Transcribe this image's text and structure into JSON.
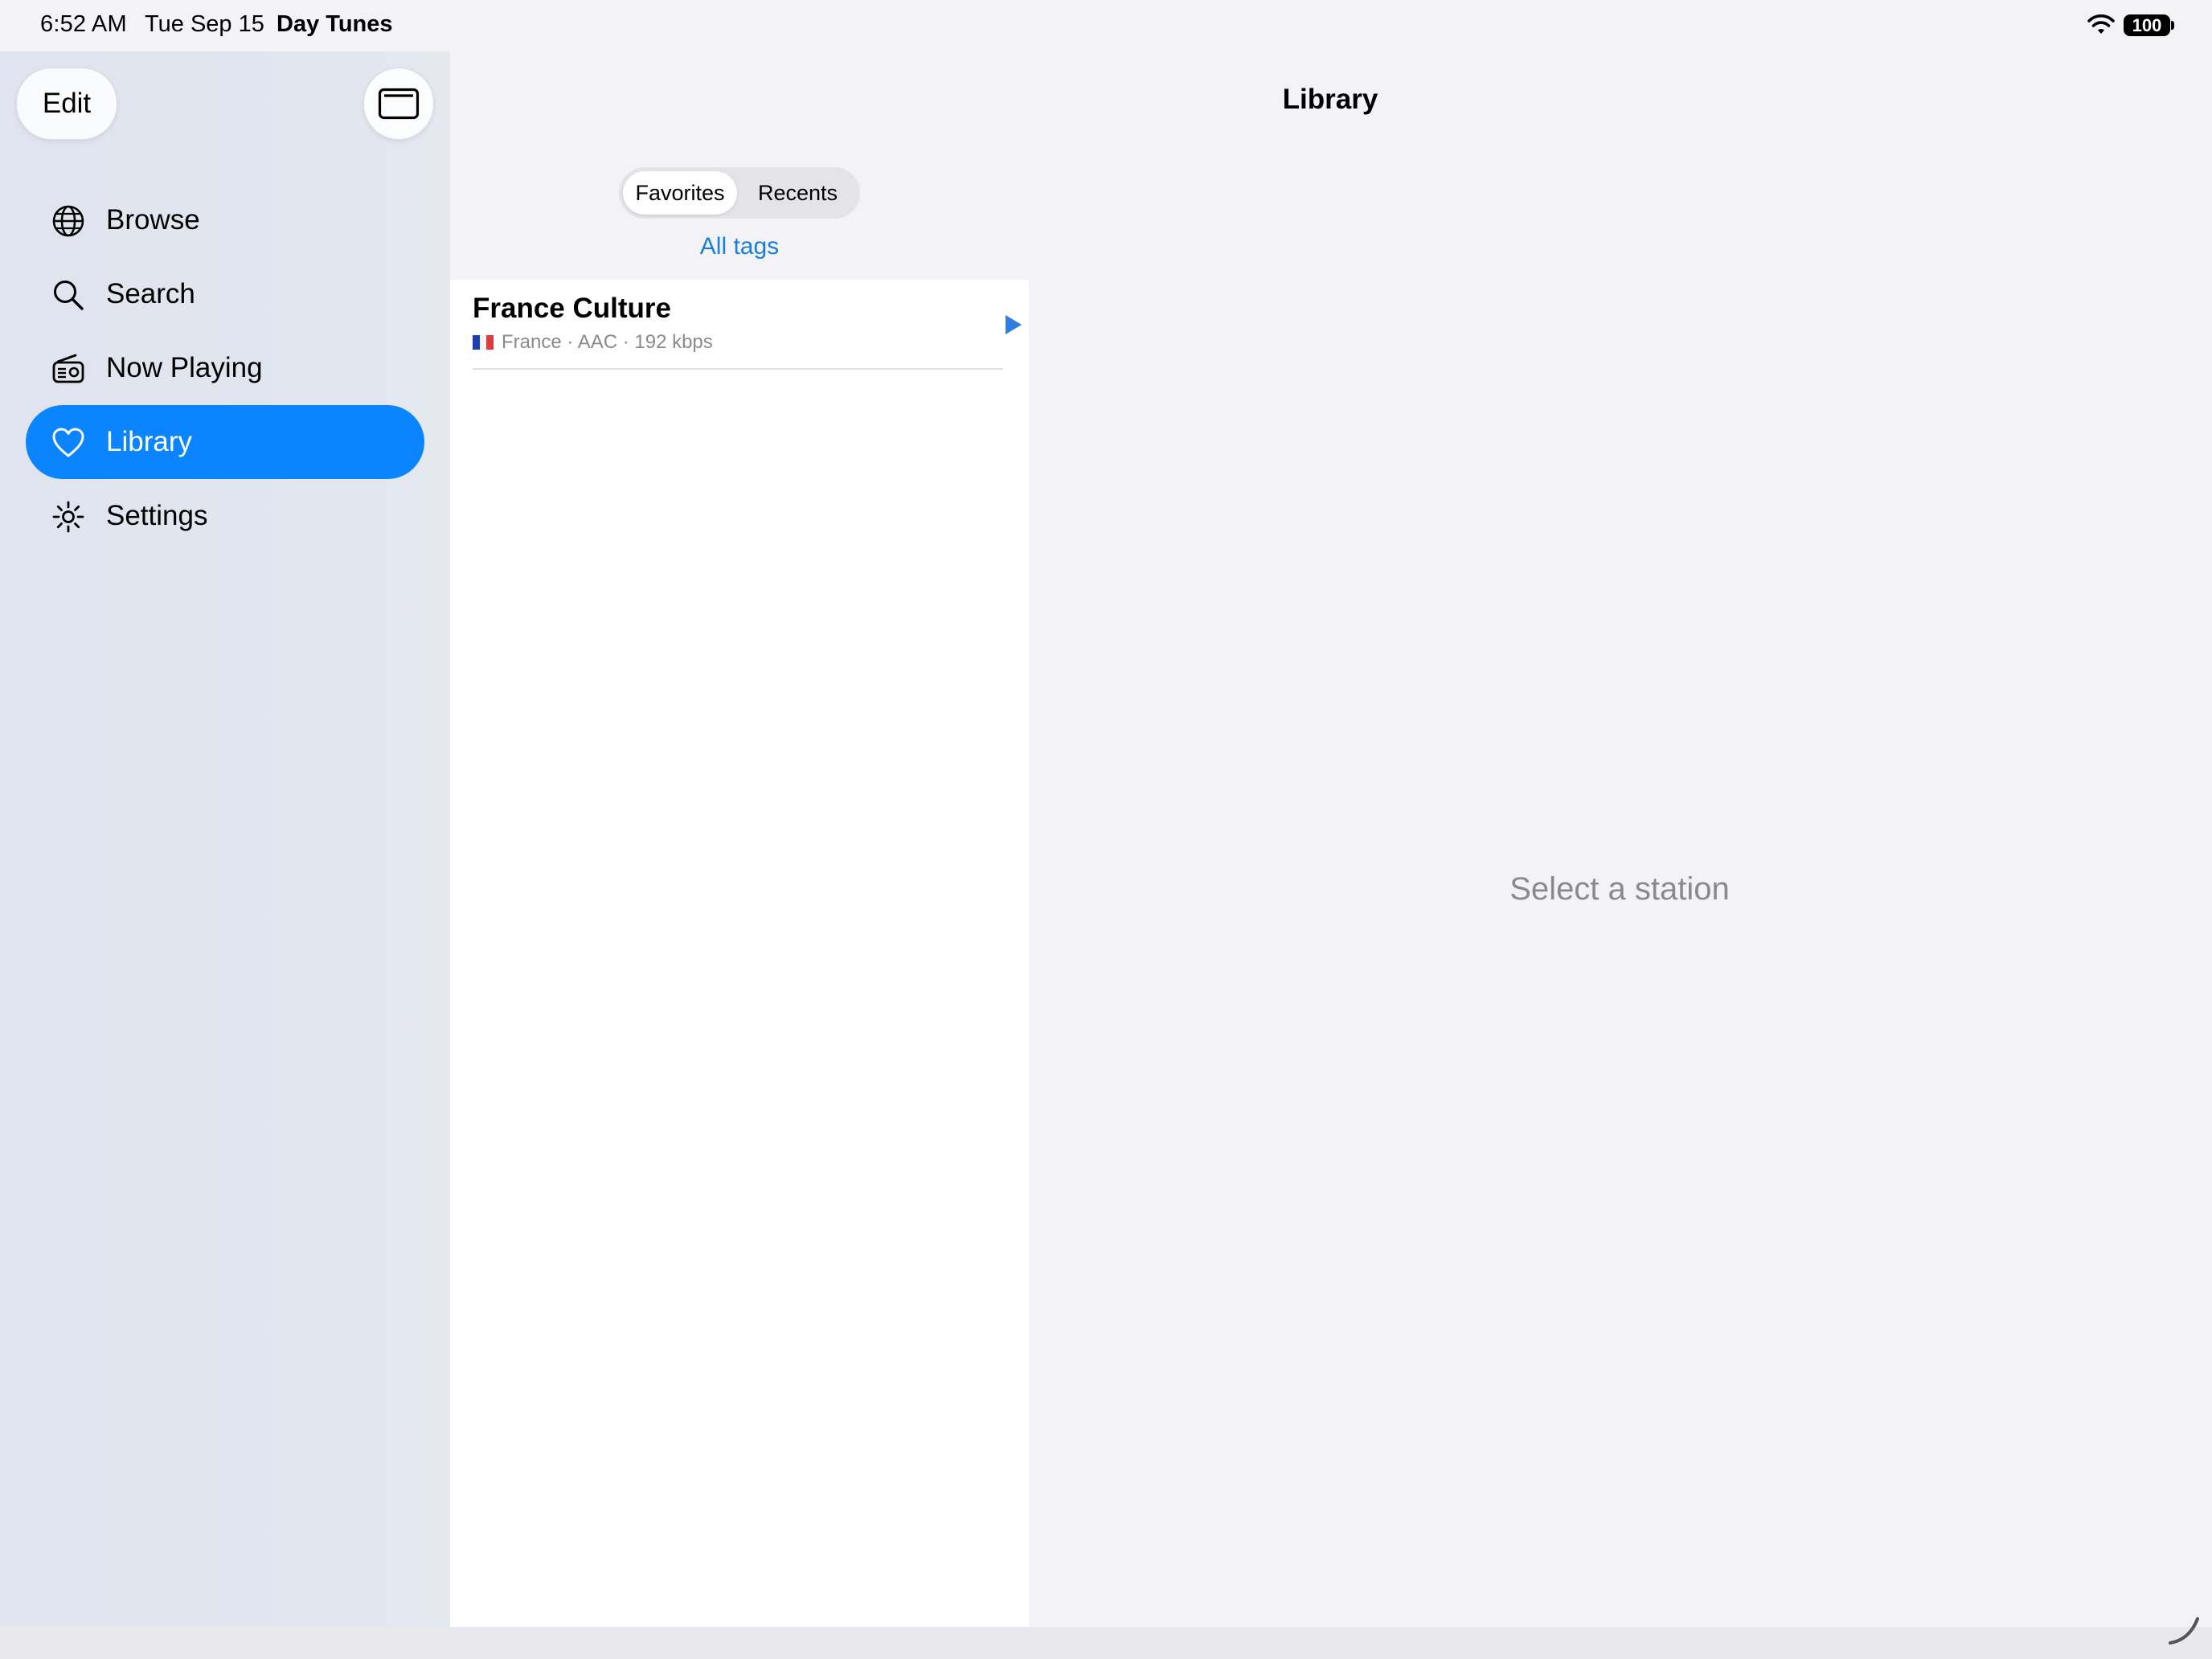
{
  "status_bar": {
    "time": "6:52 AM",
    "date": "Tue Sep 15",
    "app_name": "Day Tunes",
    "battery": "100"
  },
  "sidebar": {
    "edit_label": "Edit",
    "items": [
      {
        "label": "Browse",
        "icon": "globe-icon"
      },
      {
        "label": "Search",
        "icon": "search-icon"
      },
      {
        "label": "Now Playing",
        "icon": "radio-icon"
      },
      {
        "label": "Library",
        "icon": "heart-icon",
        "active": true
      },
      {
        "label": "Settings",
        "icon": "gear-icon"
      }
    ]
  },
  "main": {
    "title": "Library",
    "segments": [
      "Favorites",
      "Recents"
    ],
    "selected_segment": "Favorites",
    "all_tags_label": "All tags",
    "stations": [
      {
        "name": "France Culture",
        "country": "France",
        "meta": "France · AAC · 192 kbps"
      }
    ]
  },
  "detail": {
    "placeholder": "Select a station"
  },
  "colors": {
    "accent": "#0a84ff",
    "link": "#1a7fd9",
    "secondary_text": "#8a8a8e"
  }
}
